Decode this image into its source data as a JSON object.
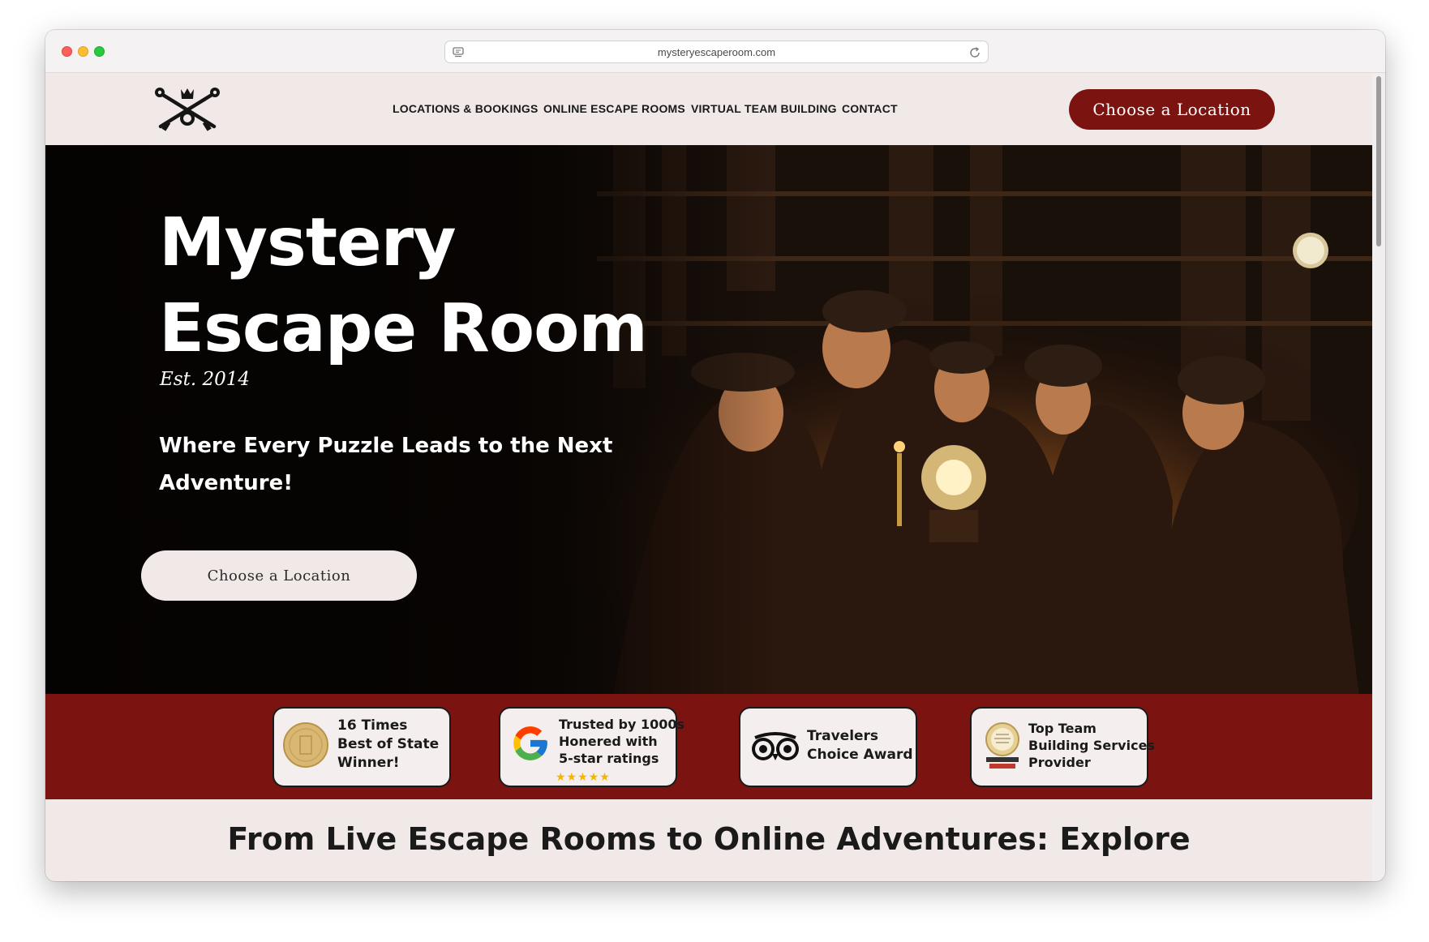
{
  "browser": {
    "url": "mysteryescaperoom.com"
  },
  "nav": {
    "items": [
      {
        "label": "LOCATIONS & BOOKINGS"
      },
      {
        "label": "ONLINE ESCAPE ROOMS"
      },
      {
        "label": "VIRTUAL TEAM BUILDING"
      },
      {
        "label": "CONTACT"
      }
    ],
    "cta_label": "Choose a Location"
  },
  "hero": {
    "title_line1": "Mystery",
    "title_line2": "Escape Room",
    "est": "Est. 2014",
    "tagline": "Where Every Puzzle Leads to the Next Adventure!",
    "cta_label": "Choose a Location"
  },
  "awards": [
    {
      "icon": "gold-medal-icon",
      "lines": [
        "16 Times",
        "Best of State",
        "Winner!"
      ]
    },
    {
      "icon": "google-logo-icon",
      "lines": [
        "Trusted by 1000s",
        "Honered with",
        "5-star ratings"
      ],
      "stars": "★★★★★"
    },
    {
      "icon": "tripadvisor-owl-icon",
      "lines": [
        "Travelers",
        "Choice Award"
      ]
    },
    {
      "icon": "team-building-badge-icon",
      "lines": [
        "Top Team",
        "Building Services",
        "Provider"
      ]
    }
  ],
  "section": {
    "title": "From Live Escape Rooms to Online Adventures: Explore"
  },
  "colors": {
    "brand_red": "#7b1410",
    "page_bg": "#f1e9e7",
    "star_gold": "#f5b400"
  }
}
